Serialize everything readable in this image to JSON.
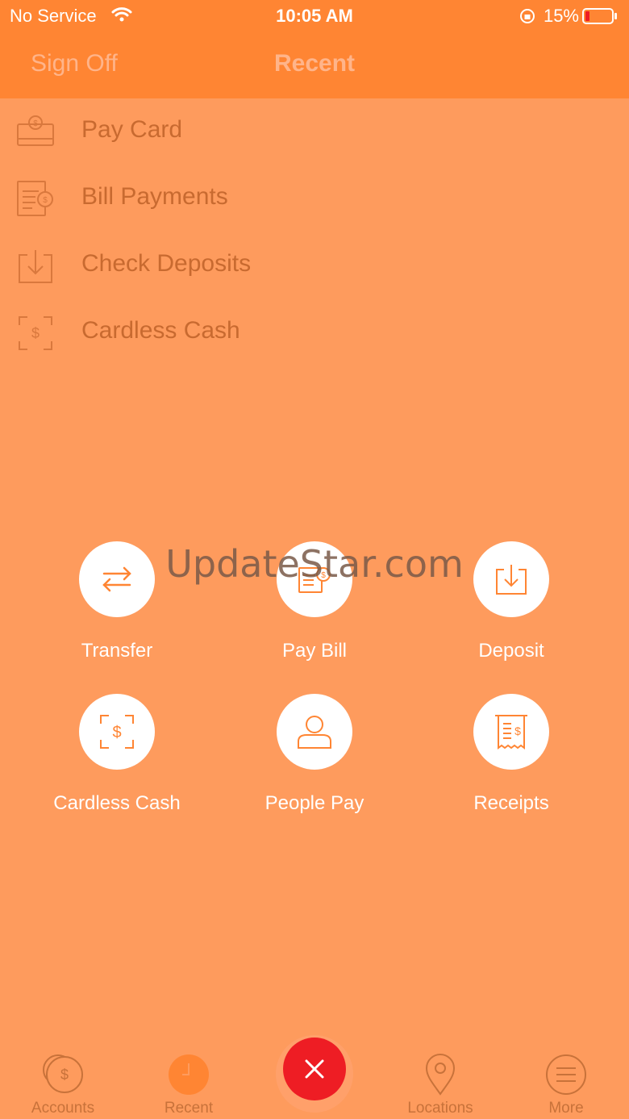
{
  "status": {
    "carrier": "No Service",
    "time": "10:05 AM",
    "battery": "15%"
  },
  "nav": {
    "sign_off": "Sign Off",
    "title": "Recent"
  },
  "menu": [
    {
      "label": "Pay Card",
      "icon": "pay-card-icon"
    },
    {
      "label": "Bill Payments",
      "icon": "bill-payment-icon"
    },
    {
      "label": "Check Deposits",
      "icon": "deposit-icon"
    },
    {
      "label": "Cardless Cash",
      "icon": "cardless-cash-icon"
    }
  ],
  "watermark": "UpdateStar.com",
  "actions": [
    {
      "label": "Transfer",
      "icon": "transfer-icon"
    },
    {
      "label": "Pay Bill",
      "icon": "pay-bill-icon"
    },
    {
      "label": "Deposit",
      "icon": "deposit-icon"
    },
    {
      "label": "Cardless Cash",
      "icon": "cardless-cash-icon"
    },
    {
      "label": "People Pay",
      "icon": "person-icon"
    },
    {
      "label": "Receipts",
      "icon": "receipt-icon"
    }
  ],
  "tabs": [
    {
      "label": "Accounts",
      "icon": "coin-icon"
    },
    {
      "label": "Recent",
      "icon": "clock-icon"
    },
    {
      "label": "Locations",
      "icon": "location-pin-icon"
    },
    {
      "label": "More",
      "icon": "menu-icon"
    }
  ],
  "colors": {
    "header": "#ff8533",
    "overlay": "#fe9b5d",
    "accent": "#ee1d24",
    "icon_orange": "#ff8533"
  }
}
